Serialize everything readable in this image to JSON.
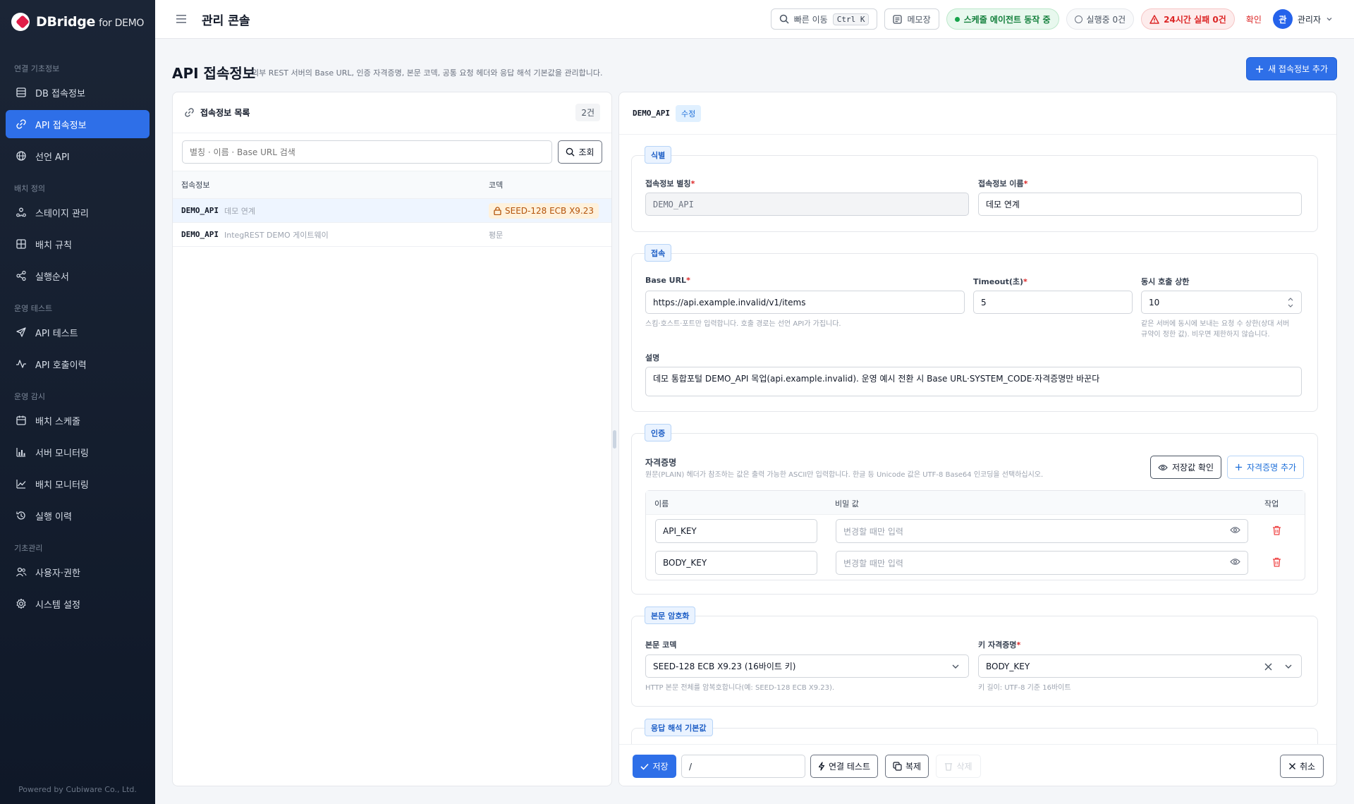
{
  "brand": {
    "name": "DBridge",
    "suffix": "for DEMO"
  },
  "sidebar": {
    "sections": [
      {
        "title": "연결 기초정보",
        "items": [
          {
            "label": "DB 접속정보",
            "icon": "database-icon"
          },
          {
            "label": "API 접속정보",
            "icon": "link-icon",
            "active": true
          },
          {
            "label": "선언 API",
            "icon": "globe-icon"
          }
        ]
      },
      {
        "title": "배치 정의",
        "items": [
          {
            "label": "스테이지 관리",
            "icon": "stage-icon"
          },
          {
            "label": "배치 규칙",
            "icon": "grid-icon"
          },
          {
            "label": "실행순서",
            "icon": "share-icon"
          }
        ]
      },
      {
        "title": "운영 테스트",
        "items": [
          {
            "label": "API 테스트",
            "icon": "send-icon"
          },
          {
            "label": "API 호출이력",
            "icon": "activity-icon"
          }
        ]
      },
      {
        "title": "운영 감시",
        "items": [
          {
            "label": "배치 스케줄",
            "icon": "calendar-icon"
          },
          {
            "label": "서버 모니터링",
            "icon": "bar-chart-icon"
          },
          {
            "label": "배치 모니터링",
            "icon": "trend-icon"
          },
          {
            "label": "실행 이력",
            "icon": "history-icon"
          }
        ]
      },
      {
        "title": "기초관리",
        "items": [
          {
            "label": "사용자·권한",
            "icon": "users-icon"
          },
          {
            "label": "시스템 설정",
            "icon": "gear-icon"
          }
        ]
      }
    ],
    "footer": "Powered by Cubiware Co., Ltd."
  },
  "header": {
    "title": "관리 콘솔",
    "quick_jump": "빠른 이동",
    "shortcut": "Ctrl K",
    "memo": "메모장",
    "scheduler_status": "스케줄 에이전트 동작 중",
    "running": "실행중 0건",
    "failures": "24시간 실패 0건",
    "confirm": "확인",
    "user_initial": "관",
    "user_name": "관리자"
  },
  "page": {
    "title": "API 접속정보",
    "subtitle": "외부 REST 서버의 Base URL, 인증 자격증명, 본문 코덱, 공통 요청 헤더와 응답 해석 기본값을 관리합니다.",
    "add_button": "새 접속정보 추가"
  },
  "list": {
    "title": "접속정보 목록",
    "count": "2건",
    "search_placeholder": "별칭 · 이름 · Base URL 검색",
    "search_button": "조회",
    "columns": [
      "접속정보",
      "코덱"
    ],
    "rows": [
      {
        "alias": "DEMO_API",
        "name": "데모 연계",
        "codec": "SEED-128 ECB X9.23",
        "encrypted": true
      },
      {
        "alias": "DEMO_API",
        "name": "IntegREST DEMO 게이트웨이",
        "codec": "평문",
        "encrypted": false
      }
    ]
  },
  "detail": {
    "alias": "DEMO_API",
    "mode": "수정",
    "identity": {
      "tag": "식별",
      "alias_label": "접속정보 별칭",
      "alias_value": "DEMO_API",
      "name_label": "접속정보 이름",
      "name_value": "데모 연계"
    },
    "connection": {
      "tag": "접속",
      "base_url_label": "Base URL",
      "base_url_value": "https://api.example.invalid/v1/items",
      "base_url_hint": "스킴·호스트·포트만 입력합니다. 호출 경로는 선언 API가 가집니다.",
      "timeout_label": "Timeout(초)",
      "timeout_value": "5",
      "concurrency_label": "동시 호출 상한",
      "concurrency_value": "10",
      "concurrency_hint_1": "같은 서버에 동시에 보내는 요청 수 상한(상대 서버",
      "concurrency_hint_2": "규약이 정한 값). 비우면 제한하지 않습니다.",
      "desc_label": "설명",
      "desc_value": "데모 통합포털 DEMO_API 목업(api.example.invalid). 운영 예시 전환 시 Base URL·SYSTEM_CODE·자격증명만 바꾼다"
    },
    "auth": {
      "tag": "인증",
      "title": "자격증명",
      "hint": "원문(PLAIN) 헤더가 참조하는 값은 출력 가능한 ASCII만 입력합니다. 한글 등 Unicode 값은 UTF-8 Base64 인코딩을 선택하십시오.",
      "check_button": "저장값 확인",
      "add_button": "자격증명 추가",
      "columns": [
        "이름",
        "비밀 값",
        "작업"
      ],
      "secret_placeholder": "변경할 때만 입력",
      "credentials": [
        {
          "name": "API_KEY"
        },
        {
          "name": "BODY_KEY"
        }
      ]
    },
    "body": {
      "tag": "본문 암호화",
      "codec_label": "본문 코덱",
      "codec_value": "SEED-128 ECB X9.23 (16바이트 키)",
      "codec_hint": "HTTP 본문 전체를 암복호합니다(예: SEED-128 ECB X9.23).",
      "key_label": "키 자격증명",
      "key_value": "BODY_KEY",
      "key_hint": "키 길이: UTF-8 기준 16바이트"
    },
    "response": {
      "tag": "응답 해석 기본값"
    }
  },
  "actions": {
    "save": "저장",
    "path_value": "/",
    "test": "연결 테스트",
    "copy": "복제",
    "delete": "삭제",
    "cancel": "취소"
  }
}
